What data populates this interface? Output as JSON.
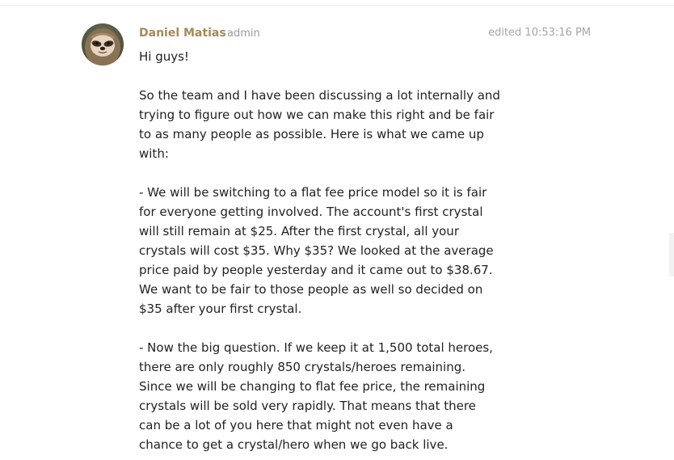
{
  "colors": {
    "username": "#a38b56",
    "meta": "#9a9a9a",
    "body_text": "#222222"
  },
  "post": {
    "avatar_icon": "sloth-avatar-icon",
    "username": "Daniel Matias",
    "role": "admin",
    "edited": "edited 10:53:16 PM",
    "greeting": "Hi guys!",
    "paragraphs": [
      [
        "So the team and I have been discussing a lot internally and",
        "trying to figure out how we can make this right and be fair",
        "to as many people as possible. Here is what we came up",
        "with:"
      ],
      [
        "- We will be switching to a flat fee price model so it is fair",
        "for everyone getting involved. The account's first crystal",
        "will still remain at $25. After the first crystal, all your",
        "crystals will cost $35. Why $35? We looked at the average",
        "price paid by people yesterday and it came out to $38.67.",
        "We want to be fair to those people as well so decided on",
        "$35 after your first crystal."
      ],
      [
        "- Now the big question. If we keep it at 1,500 total heroes,",
        "there are only roughly 850 crystals/heroes remaining.",
        "Since we will be changing to flat fee price, the remaining",
        "crystals will be sold very rapidly. That means that there",
        "can be a lot of you here that might not even have a",
        "chance to get a crystal/hero when we go back live."
      ]
    ]
  }
}
